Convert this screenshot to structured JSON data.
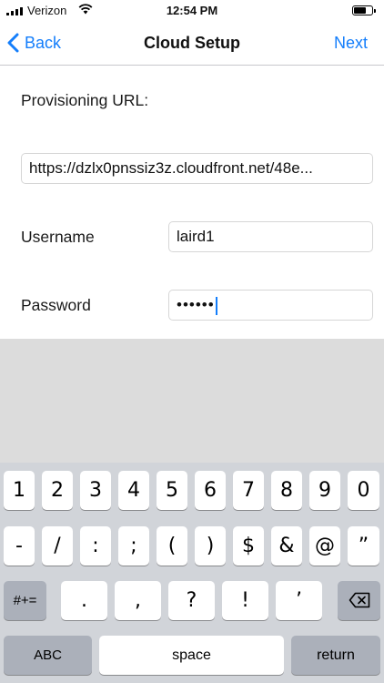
{
  "status_bar": {
    "carrier": "Verizon",
    "time": "12:54 PM"
  },
  "nav": {
    "back_label": "Back",
    "title": "Cloud Setup",
    "next_label": "Next"
  },
  "form": {
    "provisioning_label": "Provisioning URL:",
    "provisioning_value": "https://dzlx0pnssiz3z.cloudfront.net/48e...",
    "username_label": "Username",
    "username_value": "laird1",
    "password_label": "Password",
    "password_value": "••••••"
  },
  "keyboard": {
    "row1": [
      "1",
      "2",
      "3",
      "4",
      "5",
      "6",
      "7",
      "8",
      "9",
      "0"
    ],
    "row2": [
      "-",
      "/",
      ":",
      ";",
      "(",
      ")",
      "$",
      "&",
      "@",
      "”"
    ],
    "row3_shift": "#+=",
    "row3": [
      ".",
      ",",
      "?",
      "!",
      "’"
    ],
    "abc": "ABC",
    "space": "space",
    "return": "return",
    "delete_icon": "backspace-icon"
  },
  "colors": {
    "accent": "#147efb",
    "keyboard_bg": "#d1d4d9",
    "empty_area_bg": "#dcdcdc"
  }
}
